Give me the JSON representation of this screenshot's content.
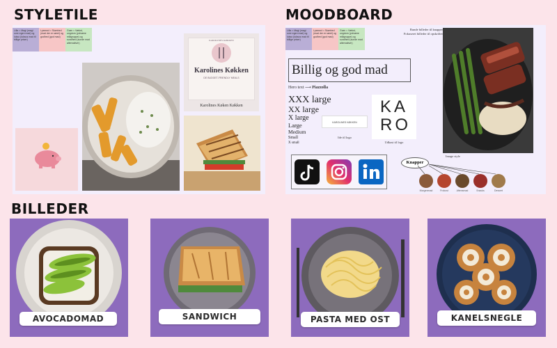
{
  "sections": {
    "styletile": "STYLETILE",
    "moodboard": "MOODBOARD",
    "billeder": "BILLEDER"
  },
  "colors": {
    "background": "#fce4ea",
    "panel": "#f3eefc",
    "lilla": "#b9aed6",
    "lyserod": "#f7c6c6",
    "gron": "#c7e7c1",
    "purple_bg": "#8d6bbd"
  },
  "swatches": [
    "Lilla = Magi (magi over egen mad) og lukso (luksus mad til billige priser)",
    "Lyserød = Skønhed (mad der er sæet) og godhed (god mad)",
    "Grøn = Vækst, ungdom (primære målgruppe) og sundhed (sunde mad alternativer)"
  ],
  "styletile": {
    "logo_top": "KAROLINES KØKKEN",
    "logo_title": "Karolines Køkken",
    "logo_sub": "DE BUDGET-FRIENDLY MEALS",
    "logo_caption": "Karolines Køken Køkken",
    "piggy_icon": "piggy-bank-icon"
  },
  "moodboard": {
    "notes": [
      "Runde billeder til knapper",
      "Fokuseret billeder til opskrifter"
    ],
    "title_box": "Billig og god mad",
    "hero_label": "Hero text",
    "hero_font": "Piazzolla",
    "type_scale": [
      "XXX large",
      "XX large",
      "X large",
      "Large",
      "Medium",
      "Small",
      "X small"
    ],
    "logo_idea_text": "KAROLINES KØKKEN",
    "logo_idea_caption": "Ide til logo",
    "big_logo_top": "KA",
    "big_logo_bottom": "RO",
    "big_logo_caption": "Udkast til logo",
    "image_caption": "Image style",
    "social_icons": [
      "tiktok-icon",
      "instagram-icon",
      "linkedin-icon"
    ],
    "knapper_label": "Knapper",
    "buttons": [
      "Morgenmad",
      "Frokost",
      "Aftensmad",
      "Snacks",
      "Dessert"
    ]
  },
  "billeder": [
    {
      "label": "AVOCADOMAD"
    },
    {
      "label": "SANDWICH"
    },
    {
      "label": "PASTA MED OST"
    },
    {
      "label": "KANELSNEGLE"
    }
  ]
}
